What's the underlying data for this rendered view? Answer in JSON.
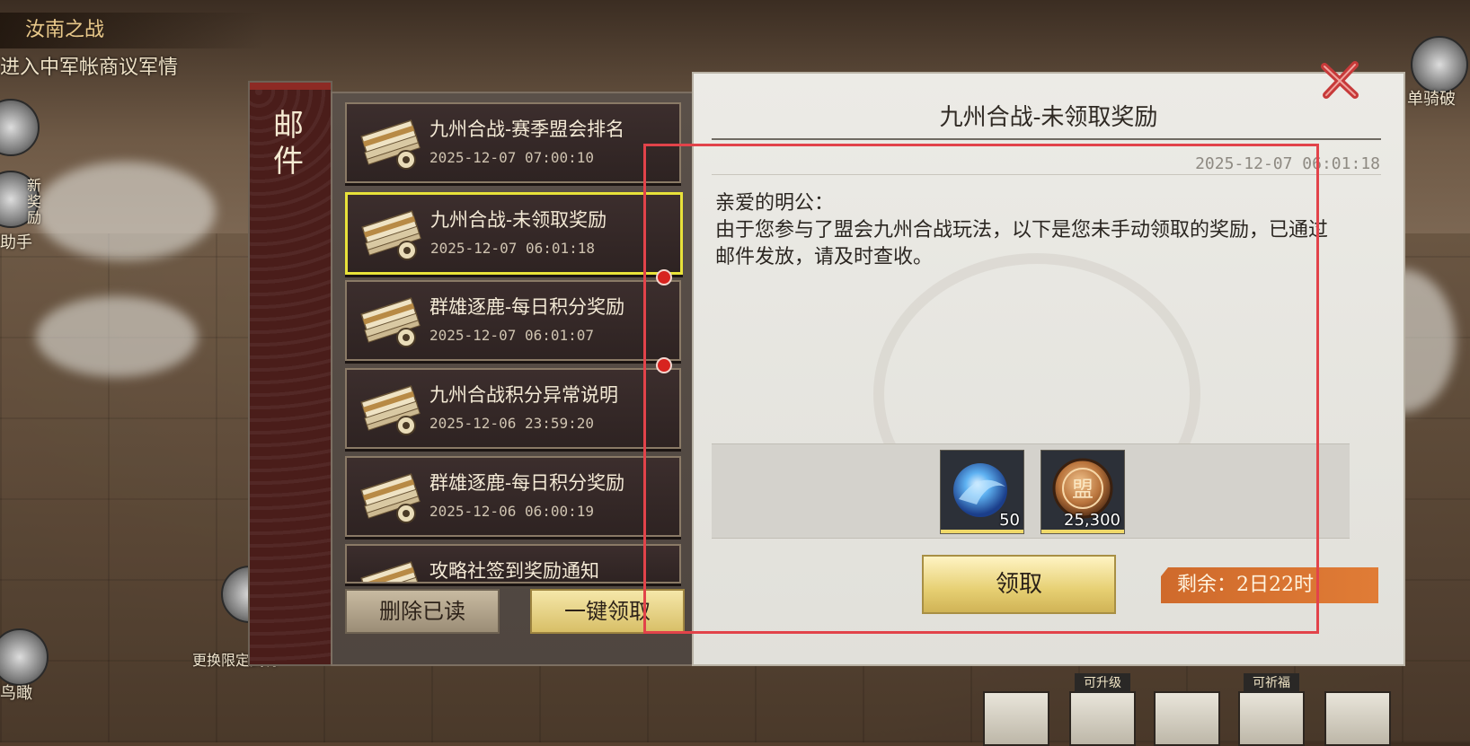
{
  "quest": {
    "title": "汝南之战",
    "subtitle": "进入中军帐商议军情"
  },
  "side": {
    "left_labels": [
      "新奖励",
      "助手",
      "鸟瞰",
      "更换限定武将"
    ],
    "right_label": "单骑破"
  },
  "tab": {
    "title": "邮件"
  },
  "mails": [
    {
      "title": "九州合战-赛季盟会排名",
      "date": "2025-12-07 07:00:10",
      "selected": false,
      "unread": false
    },
    {
      "title": "九州合战-未领取奖励",
      "date": "2025-12-07 06:01:18",
      "selected": true,
      "unread": false
    },
    {
      "title": "群雄逐鹿-每日积分奖励",
      "date": "2025-12-07 06:01:07",
      "selected": false,
      "unread": true
    },
    {
      "title": "九州合战积分异常说明",
      "date": "2025-12-06 23:59:20",
      "selected": false,
      "unread": true
    },
    {
      "title": "群雄逐鹿-每日积分奖励",
      "date": "2025-12-06 06:00:19",
      "selected": false,
      "unread": false
    },
    {
      "title": "攻略社签到奖励通知",
      "date": "",
      "selected": false,
      "unread": false
    }
  ],
  "list_buttons": {
    "delete_read": "删除已读",
    "claim_all": "一键领取"
  },
  "detail": {
    "title": "九州合战-未领取奖励",
    "date": "2025-12-07 06:01:18",
    "greeting": "亲爱的明公：",
    "body": "由于您参与了盟会九州合战玩法，以下是您未手动领取的奖励，已通过邮件发放，请及时查收。",
    "rewards": [
      {
        "icon": "blue-orb-icon",
        "quantity": "50"
      },
      {
        "icon": "alliance-coin-icon",
        "quantity": "25,300"
      }
    ],
    "claim_button": "领取",
    "remaining": "剩余：2日22时"
  },
  "bottom_tags": [
    "可升级",
    "可祈福"
  ],
  "colors": {
    "selected_border": "#e8e23a",
    "unread_dot": "#d7231f",
    "remaining_bg": "#e07c36",
    "highlight": "#e2434a"
  }
}
